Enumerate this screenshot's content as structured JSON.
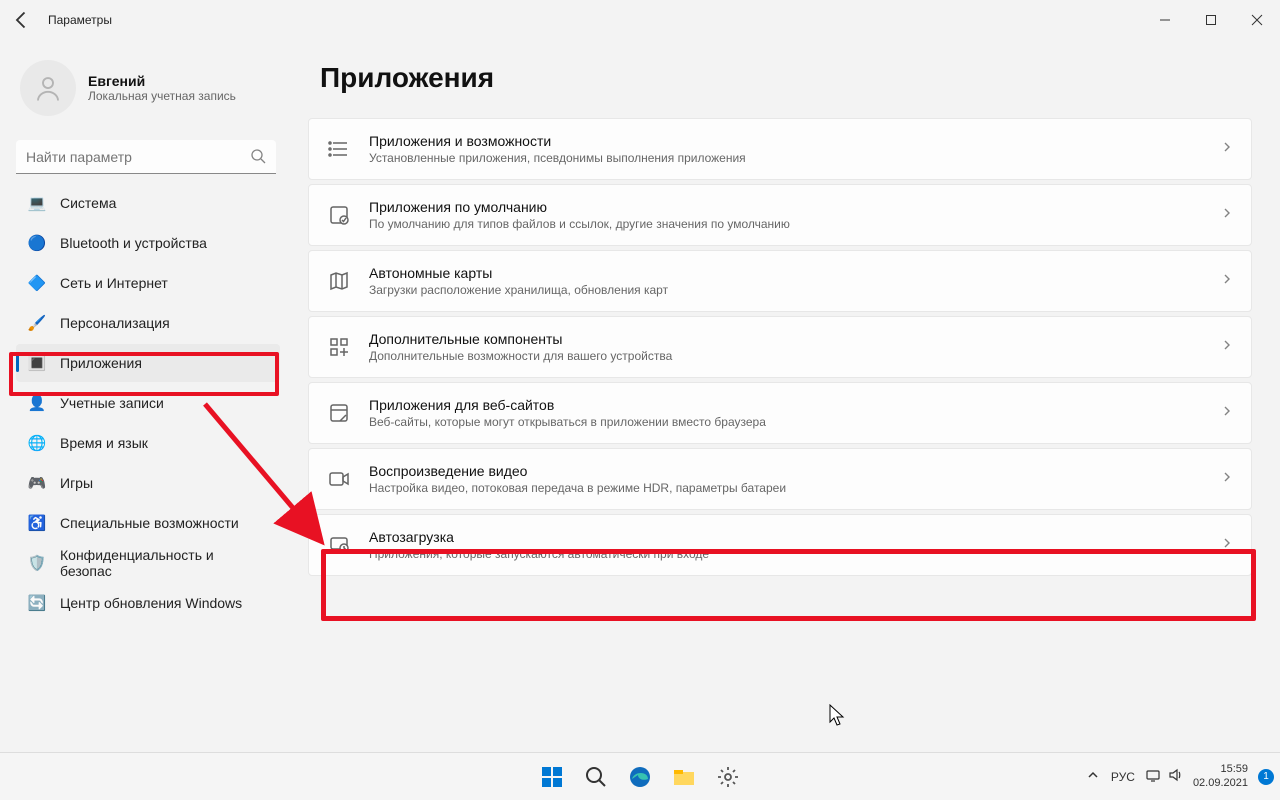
{
  "window": {
    "title": "Параметры"
  },
  "profile": {
    "name": "Евгений",
    "type": "Локальная учетная запись"
  },
  "search": {
    "placeholder": "Найти параметр"
  },
  "sidebar": {
    "items": [
      {
        "label": "Система",
        "icon": "💻",
        "selected": false
      },
      {
        "label": "Bluetooth и устройства",
        "icon": "🔵",
        "selected": false
      },
      {
        "label": "Сеть и Интернет",
        "icon": "🔷",
        "selected": false
      },
      {
        "label": "Персонализация",
        "icon": "🖌️",
        "selected": false
      },
      {
        "label": "Приложения",
        "icon": "🔳",
        "selected": true
      },
      {
        "label": "Учетные записи",
        "icon": "👤",
        "selected": false
      },
      {
        "label": "Время и язык",
        "icon": "🌐",
        "selected": false
      },
      {
        "label": "Игры",
        "icon": "🎮",
        "selected": false
      },
      {
        "label": "Специальные возможности",
        "icon": "♿",
        "selected": false
      },
      {
        "label": "Конфиденциальность и безопас",
        "icon": "🛡️",
        "selected": false
      },
      {
        "label": "Центр обновления Windows",
        "icon": "🔄",
        "selected": false
      }
    ]
  },
  "main": {
    "title": "Приложения",
    "rows": [
      {
        "title": "Приложения и возможности",
        "desc": "Установленные приложения, псевдонимы выполнения приложения",
        "icon": "list"
      },
      {
        "title": "Приложения по умолчанию",
        "desc": "По умолчанию для типов файлов и ссылок, другие значения по умолчанию",
        "icon": "default"
      },
      {
        "title": "Автономные карты",
        "desc": "Загрузки расположение хранилища, обновления карт",
        "icon": "map"
      },
      {
        "title": "Дополнительные компоненты",
        "desc": "Дополнительные возможности для вашего устройства",
        "icon": "plus"
      },
      {
        "title": "Приложения для веб-сайтов",
        "desc": "Веб-сайты, которые могут открываться в приложении вместо браузера",
        "icon": "web"
      },
      {
        "title": "Воспроизведение видео",
        "desc": "Настройка видео, потоковая передача в режиме HDR, параметры батареи",
        "icon": "video"
      },
      {
        "title": "Автозагрузка",
        "desc": "Приложения, которые запускаются автоматически при входе",
        "icon": "startup"
      }
    ]
  },
  "taskbar": {
    "lang": "РУС",
    "time": "15:59",
    "date": "02.09.2021",
    "notify_count": "1"
  },
  "annotations": {
    "arrow_color": "#e81123",
    "box_color": "#e81123"
  }
}
